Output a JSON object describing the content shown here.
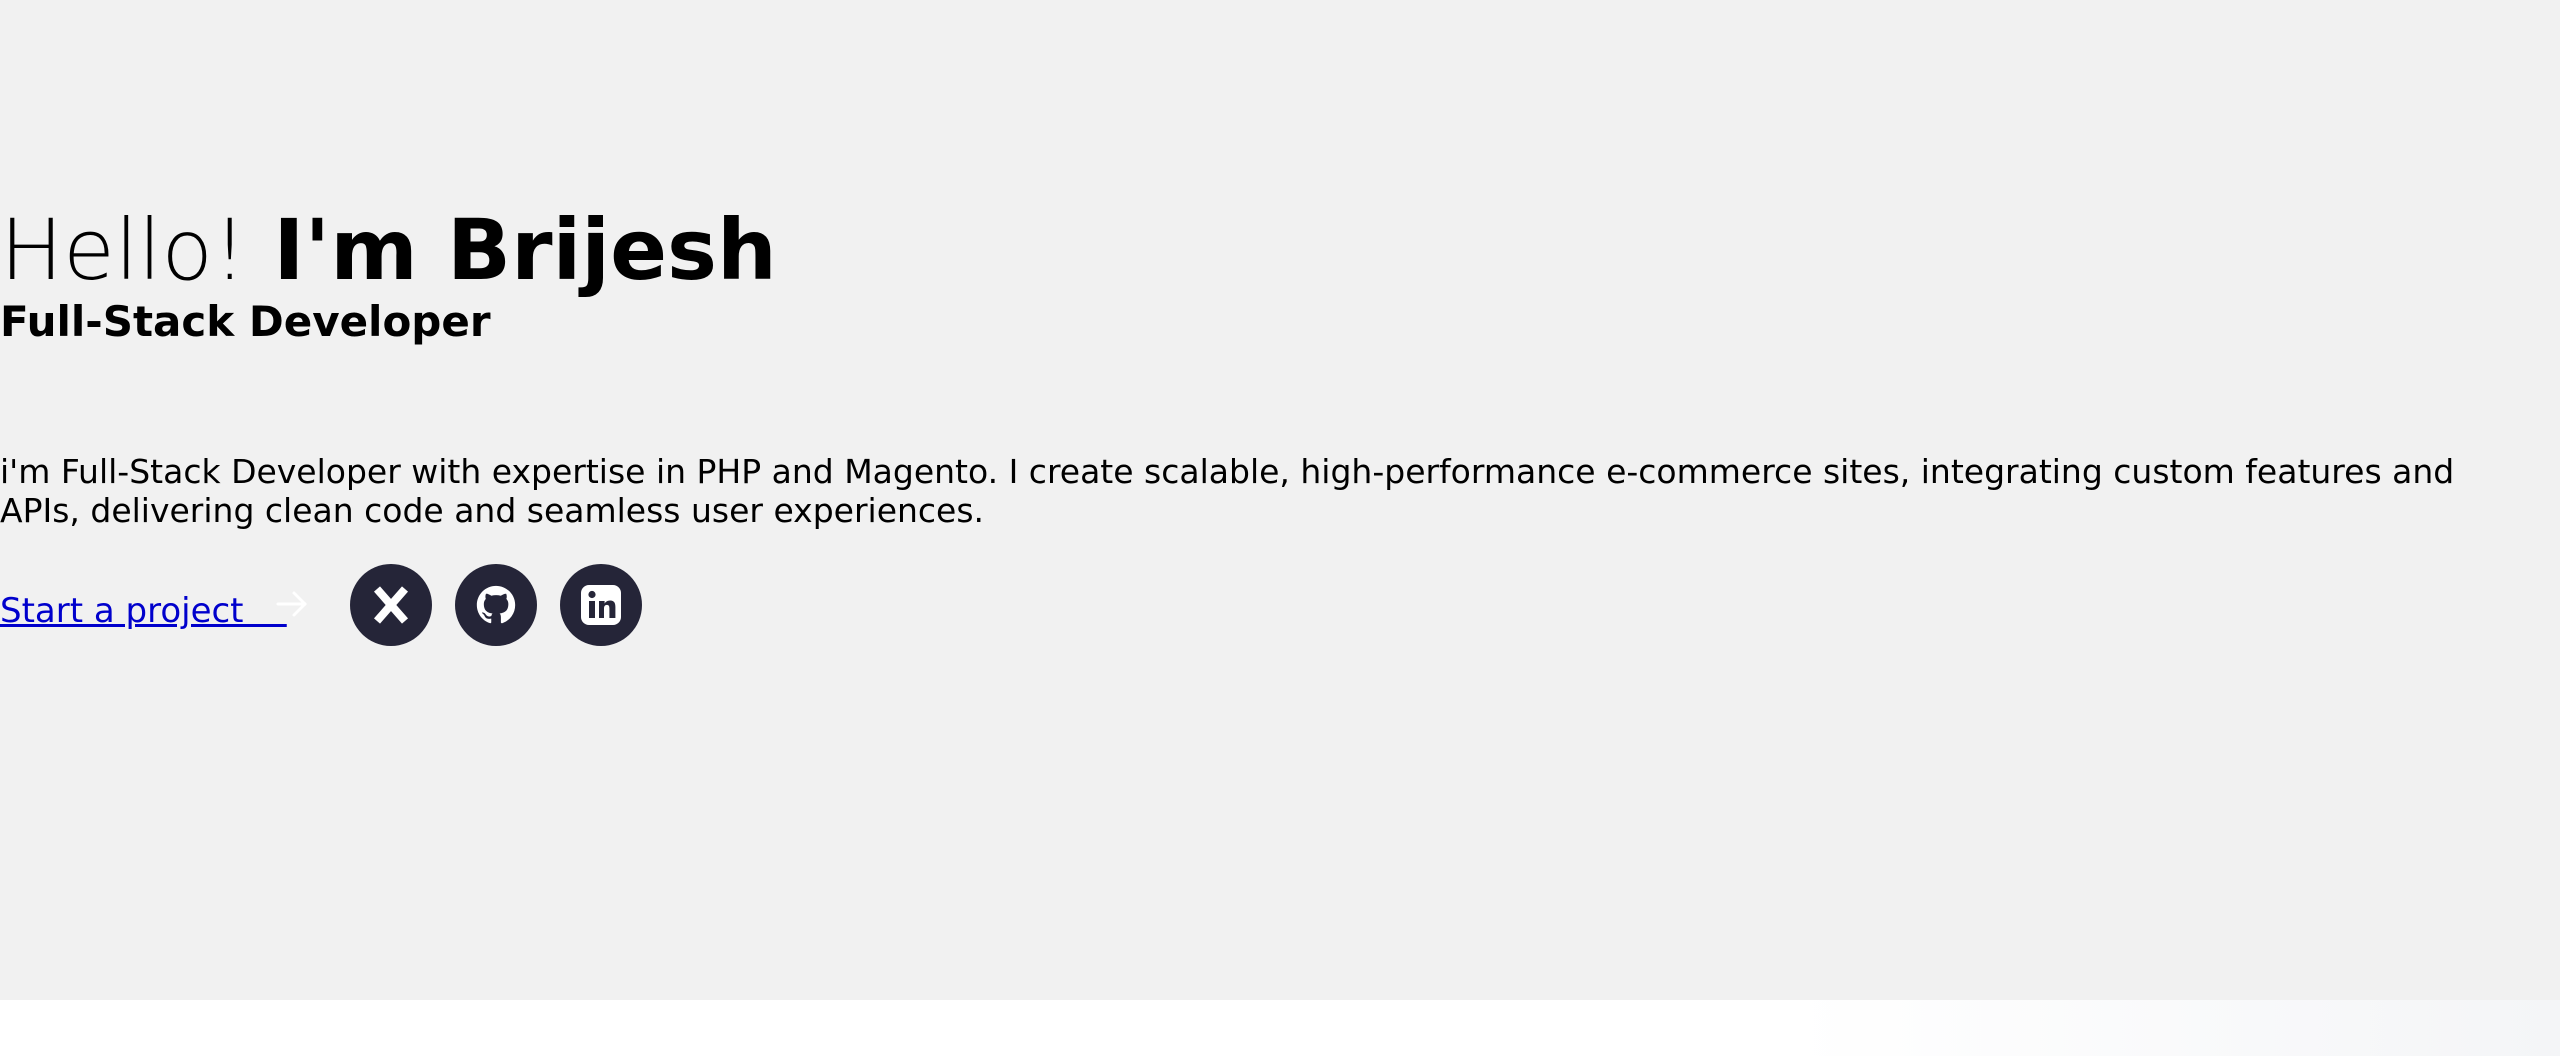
{
  "hero": {
    "greeting": "Hello!",
    "name": "I'm Brijesh",
    "role": "Full-Stack Developer",
    "intro": "i'm Full-Stack Developer with expertise in PHP and Magento. I create scalable, high-performance e-commerce sites, integrating custom features and APIs, delivering clean code and seamless user experiences.",
    "cta_label": "Start a project    ",
    "cta_icon": "arrow-right-icon"
  },
  "social": [
    {
      "name": "x-twitter",
      "icon": "x-icon"
    },
    {
      "name": "github",
      "icon": "github-icon"
    },
    {
      "name": "linkedin",
      "icon": "linkedin-icon"
    }
  ],
  "colors": {
    "hero_background": "#f1f1f1",
    "page_background": "#ffffff",
    "text": "#000000",
    "link": "#0000cc",
    "social_button": "#252538",
    "icon": "#ffffff"
  }
}
